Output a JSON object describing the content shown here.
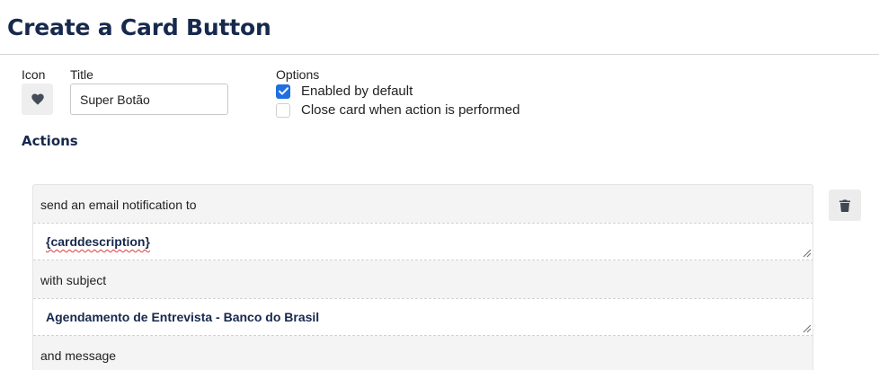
{
  "page": {
    "title": "Create a Card Button"
  },
  "form": {
    "icon_label": "Icon",
    "icon": "heart-icon",
    "title_label": "Title",
    "title_value": "Super Botão",
    "options_label": "Options",
    "options": [
      {
        "label": "Enabled by default",
        "checked": true
      },
      {
        "label": "Close card when action is performed",
        "checked": false
      }
    ]
  },
  "actions": {
    "heading": "Actions",
    "items": [
      {
        "type": "send-email",
        "text_to": "send an email notification to",
        "to_value": "{carddescription}",
        "text_subject": "with subject",
        "subject_value": "Agendamento de Entrevista - Banco do Brasil",
        "text_message": "and message",
        "delete_icon": "trash-icon"
      }
    ]
  },
  "colors": {
    "heading": "#17294d",
    "accent": "#1f6fe0",
    "panel_bg": "#f4f4f4",
    "button_bg": "#ececec"
  }
}
